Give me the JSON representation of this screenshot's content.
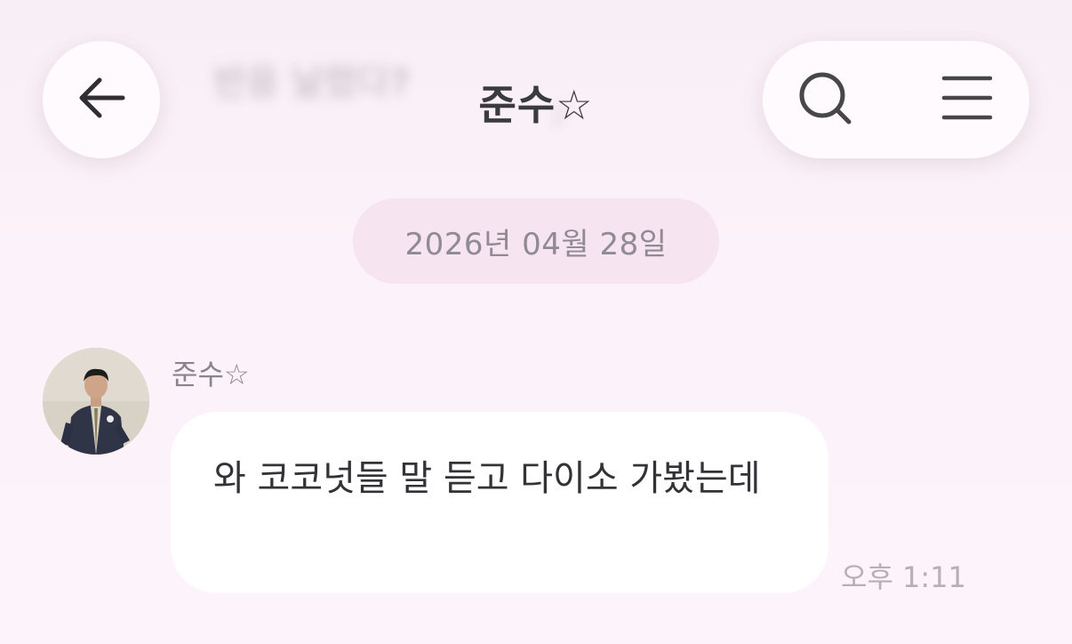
{
  "header": {
    "title": "준수☆",
    "back_icon": "arrow-left-icon",
    "search_icon": "search-icon",
    "menu_icon": "hamburger-menu-icon",
    "ghost_line1": "반응 날렸다?",
    "ghost_line2": "2"
  },
  "chat": {
    "date_separator": "2026년 04월 28일",
    "messages": [
      {
        "sender": "준수☆",
        "avatar": "profile-photo",
        "text": "와 코코넛들 말 듣고 다이소 가봤는데",
        "time": "오후 1:11"
      }
    ]
  },
  "colors": {
    "background": "#fcf2f9",
    "date_pill": "#f6e4f1",
    "bubble": "#ffffff",
    "title_text": "#3b3a3f"
  }
}
